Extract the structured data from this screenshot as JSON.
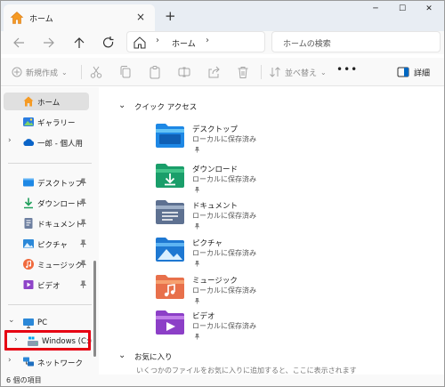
{
  "window": {
    "tab_title": "ホーム",
    "tab_close": "×",
    "new_tab": "+",
    "controls": {
      "minimize": "─",
      "maximize": "☐",
      "close": "✕"
    }
  },
  "navbar": {
    "back_icon": "arrow-left-icon",
    "forward_icon": "arrow-right-icon",
    "up_icon": "arrow-up-icon",
    "refresh_icon": "refresh-icon",
    "breadcrumb": "ホーム",
    "breadcrumb_sep": "›",
    "search_placeholder": "ホームの検索"
  },
  "commandbar": {
    "new_label": "新規作成",
    "sort_label": "並べ替え",
    "more_label": "•••",
    "details_label": "詳細"
  },
  "sidebar": {
    "chevron": "›",
    "expanded_chevron": "⌄",
    "group1": [
      {
        "label": "ホーム",
        "icon": "home-icon",
        "selected": true
      },
      {
        "label": "ギャラリー",
        "icon": "gallery-icon"
      },
      {
        "label": "一郎 - 個人用",
        "icon": "onedrive-cloud-icon"
      }
    ],
    "group2": [
      {
        "label": "デスクトップ",
        "icon": "desktop-icon"
      },
      {
        "label": "ダウンロード",
        "icon": "download-icon"
      },
      {
        "label": "ドキュメント",
        "icon": "documents-icon"
      },
      {
        "label": "ピクチャ",
        "icon": "pictures-icon"
      },
      {
        "label": "ミュージック",
        "icon": "music-icon"
      },
      {
        "label": "ビデオ",
        "icon": "videos-icon"
      }
    ],
    "pc_label": "PC",
    "drive_label": "Windows (C:)",
    "network_label": "ネットワーク"
  },
  "content": {
    "quick_access_header": "クイック アクセス",
    "favorites_header": "お気に入り",
    "favorites_hint": "いくつかのファイルをお気に入りに追加すると、ここに表示されます",
    "items": [
      {
        "name": "デスクトップ",
        "location": "ローカルに保存済み",
        "icon": "desktop-folder-icon"
      },
      {
        "name": "ダウンロード",
        "location": "ローカルに保存済み",
        "icon": "downloads-folder-icon"
      },
      {
        "name": "ドキュメント",
        "location": "ローカルに保存済み",
        "icon": "documents-folder-icon"
      },
      {
        "name": "ピクチャ",
        "location": "ローカルに保存済み",
        "icon": "pictures-folder-icon"
      },
      {
        "name": "ミュージック",
        "location": "ローカルに保存済み",
        "icon": "music-folder-icon"
      },
      {
        "name": "ビデオ",
        "location": "ローカルに保存済み",
        "icon": "videos-folder-icon"
      }
    ]
  },
  "statusbar": {
    "item_count": "6 個の項目"
  },
  "colors": {
    "accent": "#0067c0",
    "highlight": "#e60012",
    "selected": "#e0e0e0"
  }
}
